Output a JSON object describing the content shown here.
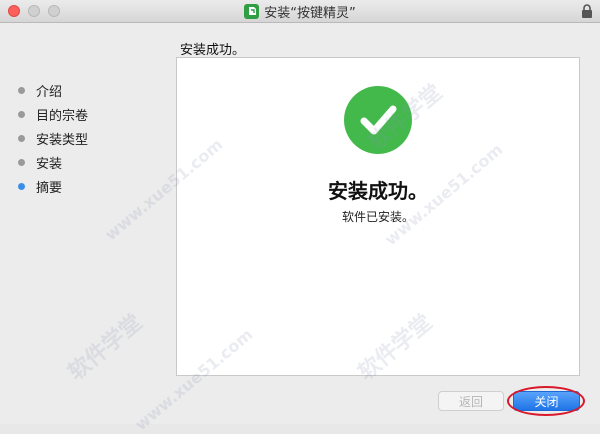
{
  "window": {
    "title": "安装“按键精灵”"
  },
  "sidebar": {
    "steps": [
      {
        "label": "介绍"
      },
      {
        "label": "目的宗卷"
      },
      {
        "label": "安装类型"
      },
      {
        "label": "安装"
      },
      {
        "label": "摘要",
        "active": true
      }
    ]
  },
  "main": {
    "heading": "安装成功。",
    "success_title": "安装成功。",
    "success_message": "软件已安装。"
  },
  "buttons": {
    "back": "返回",
    "close": "关闭"
  },
  "watermark": {
    "text": "软件学堂",
    "url": "www.xue51.com"
  },
  "colors": {
    "success_green": "#43b94c",
    "primary_blue": "#1f74e6",
    "active_step": "#3a8ee6",
    "highlight_red": "#d9192a"
  },
  "icons": {
    "success": "check-circle-icon",
    "lock": "lock-icon"
  }
}
